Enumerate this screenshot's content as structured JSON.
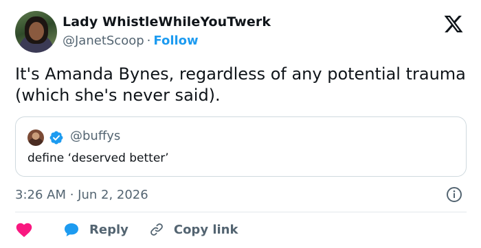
{
  "author": {
    "display_name": "Lady WhistleWhileYouTwerk",
    "handle": "@JanetScoop",
    "separator": "·",
    "follow_label": "Follow"
  },
  "tweet": {
    "text": "It's Amanda Bynes, regardless of any potential trauma (which she's never said)."
  },
  "quote": {
    "handle": "@buffys",
    "text": "define ‘deserved better’"
  },
  "meta": {
    "timestamp": "3:26 AM · Jun 2, 2026"
  },
  "actions": {
    "reply_label": "Reply",
    "copy_label": "Copy link"
  },
  "icons": {
    "logo": "x-logo-icon",
    "verified": "verified-badge-icon",
    "info": "info-icon",
    "like": "heart-icon",
    "reply": "reply-bubble-icon",
    "copy": "link-icon"
  },
  "colors": {
    "accent": "#1d9bf0",
    "like": "#f91880",
    "muted": "#536471",
    "border": "#cfd9de"
  }
}
